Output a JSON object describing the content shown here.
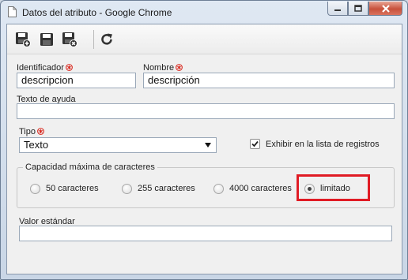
{
  "window": {
    "title": "Datos del atributo - Google Chrome",
    "controls": [
      "minimize",
      "maximize",
      "close"
    ]
  },
  "toolbar": {
    "buttons": [
      {
        "icon": "save-new-icon",
        "tooltip": ""
      },
      {
        "icon": "save-icon",
        "tooltip": ""
      },
      {
        "icon": "save-close-icon",
        "tooltip": ""
      },
      {
        "icon": "refresh-icon",
        "tooltip": ""
      }
    ]
  },
  "form": {
    "identificador": {
      "label": "Identificador",
      "value": "descripcion",
      "required": true
    },
    "nombre": {
      "label": "Nombre",
      "value": "descripción",
      "required": true
    },
    "texto_ayuda": {
      "label": "Texto de ayuda",
      "value": ""
    },
    "tipo": {
      "label": "Tipo",
      "value": "Texto",
      "required": true
    },
    "exhibir": {
      "label": "Exhibir en la lista de registros",
      "checked": true
    },
    "capacidad": {
      "legend": "Capacidad máxima de caracteres",
      "options": [
        {
          "label": "50 caracteres",
          "checked": false
        },
        {
          "label": "255 caracteres",
          "checked": false
        },
        {
          "label": "4000 caracteres",
          "checked": false
        },
        {
          "label": "limitado",
          "checked": true
        }
      ]
    },
    "valor_estandar": {
      "label": "Valor estándar",
      "value": ""
    }
  },
  "colors": {
    "required_marker": "#d9261c",
    "highlight": "#e01b24"
  }
}
